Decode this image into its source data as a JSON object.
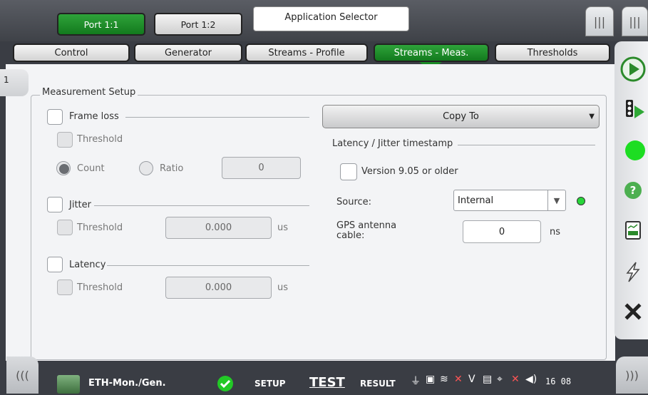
{
  "ports": [
    {
      "label": "Port 1:1",
      "active": true
    },
    {
      "label": "Port 1:2",
      "active": false
    }
  ],
  "app_selector": "Application Selector",
  "menu_icon": "|||",
  "tabs": [
    {
      "label": "Control"
    },
    {
      "label": "Generator"
    },
    {
      "label": "Streams - Profile"
    },
    {
      "label": "Streams - Meas.",
      "active": true
    },
    {
      "label": "Thresholds"
    }
  ],
  "page_tab": "1",
  "measurement": {
    "title": "Measurement Setup",
    "frame_loss": {
      "label": "Frame loss",
      "threshold": "Threshold",
      "count": "Count",
      "ratio": "Ratio",
      "value": "0",
      "selected": "Count"
    },
    "jitter": {
      "label": "Jitter",
      "threshold": "Threshold",
      "value": "0.000",
      "unit": "us"
    },
    "latency": {
      "label": "Latency",
      "threshold": "Threshold",
      "value": "0.000",
      "unit": "us"
    }
  },
  "copy_to": "Copy To",
  "timestamp": {
    "title": "Latency / Jitter timestamp",
    "version_label": "Version 9.05 or older",
    "source_label": "Source:",
    "source_value": "Internal",
    "gps_label_1": "GPS antenna",
    "gps_label_2": "cable:",
    "gps_value": "0",
    "gps_unit": "ns"
  },
  "status": {
    "app": "ETH-Mon./Gen.",
    "setup": "SETUP",
    "test": "TEST",
    "result": "RESULT",
    "clock": "16 08",
    "left_chev": "(((",
    "right_chev": ")))"
  },
  "colors": {
    "accent_green": "#1a8a26",
    "led_green": "#27d63a"
  }
}
